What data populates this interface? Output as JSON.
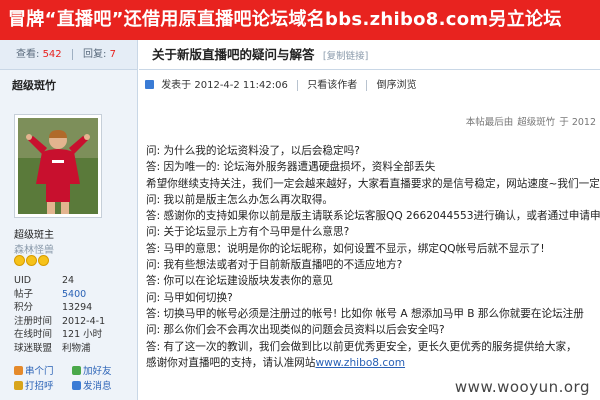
{
  "banner": {
    "headline": "冒牌“直播吧”还借用原直播吧论坛域名bbs.zhibo8.com另立论坛"
  },
  "stats": {
    "views_label": "查看:",
    "views": "542",
    "replies_label": "回复:",
    "replies": "7"
  },
  "author": {
    "name": "超级斑竹",
    "title": "超级斑主",
    "subtitle": "森林怪兽",
    "info": [
      {
        "k": "UID",
        "v": "24",
        "link": false
      },
      {
        "k": "帖子",
        "v": "5400",
        "link": true
      },
      {
        "k": "积分",
        "v": "13294",
        "link": false
      },
      {
        "k": "注册时间",
        "v": "2012-4-1",
        "link": false
      },
      {
        "k": "在线时间",
        "v": "121 小时",
        "link": false
      },
      {
        "k": "球迷联盟",
        "v": "利物浦",
        "link": false
      }
    ],
    "actions": [
      {
        "label": "串个门",
        "icon": "visit-icon"
      },
      {
        "label": "加好友",
        "icon": "add-friend-icon"
      },
      {
        "label": "打招呼",
        "icon": "greet-icon"
      },
      {
        "label": "发消息",
        "icon": "message-icon"
      }
    ]
  },
  "post": {
    "title": "关于新版直播吧的疑问与解答",
    "copy_link": "[复制链接]",
    "posted_at": "发表于  2012-4-2 11:42:06",
    "author_only": "只看该作者",
    "reverse": "倒序浏览",
    "last_edit_prefix": "本帖最后由",
    "last_edit_user": "超级斑竹",
    "last_edit_suffix": "于 2012",
    "lines": [
      "问: 为什么我的论坛资料没了，以后会稳定吗?",
      "答: 因为唯一的: 论坛海外服务器遭遇硬盘损坏，资料全部丢失",
      "希望你继续支持关注，我们一定会越来越好，大家看直播要求的是信号稳定，网站速度~我们一定",
      "问: 我以前是版主怎么办怎么再次取得。",
      "答: 感谢你的支持如果你以前是版主请联系论坛客服QQ  2662044553进行确认，或者通过申请申",
      "问: 关于论坛显示上方有个马甲是什么意思?",
      "答: 马甲的意思：说明是你的论坛昵称，如何设置不显示，绑定QQ帐号后就不显示了!",
      "问: 我有些想法或者对于目前新版直播吧的不适应地方?",
      "答: 你可以在论坛建设版块发表你的意见",
      "问: 马甲如何切换?",
      "答: 切换马甲的帐号必须是注册过的帐号!   比如你  帐号 A  想添加马甲 B 那么你就要在论坛注册",
      "问: 那么你们会不会再次出现类似的问题会员资料以后会安全吗?",
      "答: 有了这一次的教训，我们会做到比以前更优秀更安全，更长久更优秀的服务提供给大家，",
      "感谢你对直播吧的支持，请认准网站"
    ],
    "site_link": "www.zhibo8.com"
  },
  "watermark": "www.wooyun.org",
  "colors": {
    "banner": "#e8231f",
    "link": "#2a62b6",
    "sidebar": "#eef3f9"
  }
}
